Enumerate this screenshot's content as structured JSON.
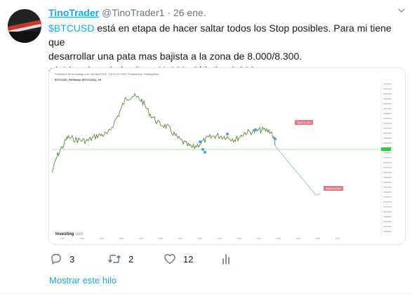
{
  "tweet": {
    "name": "TinoTrader",
    "handle": "@TinoTrader1",
    "separator": "·",
    "date": "26 ene.",
    "cashtag": "$BTCUSD",
    "line1_rest": " está en etapa de hacer saltar todos los Stop posibles. Para mi tiene que",
    "line2": "desarrollar una pata mas bajista a la zona de 8.000/8.300.",
    "line3": "+/- Idea de trabajo. Stop 11.100. Objetivo 8.300"
  },
  "chart_image": {
    "meta": "Published on Investing.com, 26/Jan/2018 - 13:03:12 GMT, Powered by TradingView.",
    "symbol": "BTC/USD, BitStamp (BTC/USD), 1H",
    "watermark": "Investing",
    "watermark_suffix": ".com",
    "stop_label": "Stop 11.100",
    "target_label": "Objetivo 8.300",
    "colors": {
      "price": "#4a7a2a",
      "horizontal": "#9bd48a",
      "projection": "#8fb4c9",
      "label": "#e07a84",
      "marker": "#4aa3df",
      "current": "#2ecc40"
    }
  },
  "actions": {
    "reply_count": "3",
    "retweet_count": "2",
    "like_count": "12"
  },
  "thread": {
    "label": "Mostrar este hilo"
  },
  "icons": [
    "chevron-down-icon",
    "reply-icon",
    "retweet-icon",
    "like-icon",
    "analytics-icon"
  ]
}
